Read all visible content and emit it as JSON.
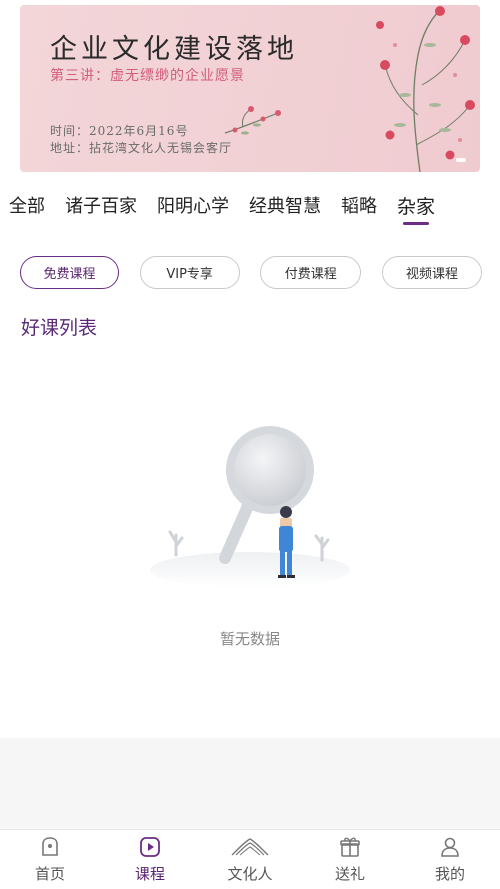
{
  "banner": {
    "title": "企业文化建设落地",
    "subtitle": "第三讲：虚无缥缈的企业愿景",
    "time": "时间：2022年6月16号",
    "address": "地址：拈花湾文化人无锡会客厅"
  },
  "categories": [
    "全部",
    "诸子百家",
    "阳明心学",
    "经典智慧",
    "韬略",
    "杂家"
  ],
  "active_category": "杂家",
  "filters": [
    "免费课程",
    "VIP专享",
    "付费课程",
    "视频课程"
  ],
  "active_filter": "免费课程",
  "section_title": "好课列表",
  "empty_text": "暂无数据",
  "tabbar": {
    "items": [
      {
        "label": "首页",
        "icon": "home-icon"
      },
      {
        "label": "课程",
        "icon": "play-icon"
      },
      {
        "label": "文化人",
        "icon": "mountain-logo-icon"
      },
      {
        "label": "送礼",
        "icon": "gift-icon"
      },
      {
        "label": "我的",
        "icon": "user-icon"
      }
    ],
    "active": "课程"
  },
  "colors": {
    "accent": "#6b2d86",
    "banner_bg": "#f2d3d7",
    "subtitle": "#d25d79"
  }
}
